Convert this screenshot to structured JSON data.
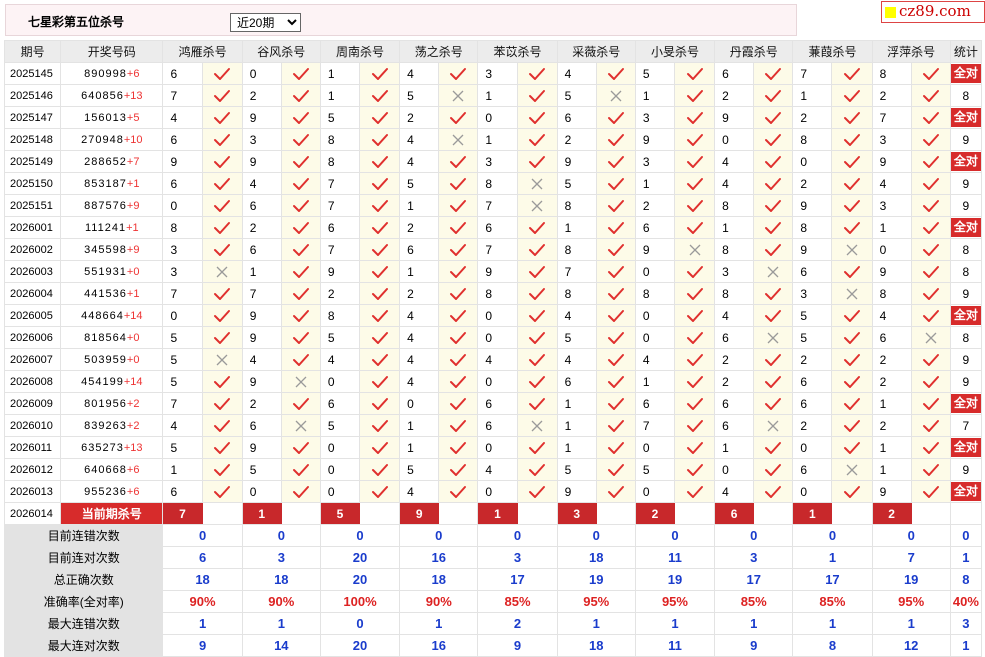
{
  "header": {
    "title": "七星彩第五位杀号",
    "period_select": {
      "value": "近20期",
      "options": [
        "近20期"
      ]
    },
    "logo_text": "cz89.com"
  },
  "columns": [
    "期号",
    "开奖号码",
    "鸿雁杀号",
    "谷风杀号",
    "周南杀号",
    "荡之杀号",
    "苯苡杀号",
    "采薇杀号",
    "小旻杀号",
    "丹霞杀号",
    "蒹葭杀号",
    "浮萍杀号",
    "统计"
  ],
  "rows": [
    {
      "period": "2025145",
      "digits": "890998",
      "plus": "+6",
      "picks": [
        [
          6,
          1
        ],
        [
          0,
          1
        ],
        [
          1,
          1
        ],
        [
          4,
          1
        ],
        [
          3,
          1
        ],
        [
          4,
          1
        ],
        [
          5,
          1
        ],
        [
          6,
          1
        ],
        [
          7,
          1
        ],
        [
          8,
          1
        ]
      ],
      "stat": "全对"
    },
    {
      "period": "2025146",
      "digits": "640856",
      "plus": "+13",
      "picks": [
        [
          7,
          1
        ],
        [
          2,
          1
        ],
        [
          1,
          1
        ],
        [
          5,
          0
        ],
        [
          1,
          1
        ],
        [
          5,
          0
        ],
        [
          1,
          1
        ],
        [
          2,
          1
        ],
        [
          1,
          1
        ],
        [
          2,
          1
        ]
      ],
      "stat": "8"
    },
    {
      "period": "2025147",
      "digits": "156013",
      "plus": "+5",
      "picks": [
        [
          4,
          1
        ],
        [
          9,
          1
        ],
        [
          5,
          1
        ],
        [
          2,
          1
        ],
        [
          0,
          1
        ],
        [
          6,
          1
        ],
        [
          3,
          1
        ],
        [
          9,
          1
        ],
        [
          2,
          1
        ],
        [
          7,
          1
        ]
      ],
      "stat": "全对"
    },
    {
      "period": "2025148",
      "digits": "270948",
      "plus": "+10",
      "picks": [
        [
          6,
          1
        ],
        [
          3,
          1
        ],
        [
          8,
          1
        ],
        [
          4,
          0
        ],
        [
          1,
          1
        ],
        [
          2,
          1
        ],
        [
          9,
          1
        ],
        [
          0,
          1
        ],
        [
          8,
          1
        ],
        [
          3,
          1
        ]
      ],
      "stat": "9"
    },
    {
      "period": "2025149",
      "digits": "288652",
      "plus": "+7",
      "picks": [
        [
          9,
          1
        ],
        [
          9,
          1
        ],
        [
          8,
          1
        ],
        [
          4,
          1
        ],
        [
          3,
          1
        ],
        [
          9,
          1
        ],
        [
          3,
          1
        ],
        [
          4,
          1
        ],
        [
          0,
          1
        ],
        [
          9,
          1
        ]
      ],
      "stat": "全对"
    },
    {
      "period": "2025150",
      "digits": "853187",
      "plus": "+1",
      "picks": [
        [
          6,
          1
        ],
        [
          4,
          1
        ],
        [
          7,
          1
        ],
        [
          5,
          1
        ],
        [
          8,
          0
        ],
        [
          5,
          1
        ],
        [
          1,
          1
        ],
        [
          4,
          1
        ],
        [
          2,
          1
        ],
        [
          4,
          1
        ]
      ],
      "stat": "9"
    },
    {
      "period": "2025151",
      "digits": "887576",
      "plus": "+9",
      "picks": [
        [
          0,
          1
        ],
        [
          6,
          1
        ],
        [
          7,
          1
        ],
        [
          1,
          1
        ],
        [
          7,
          0
        ],
        [
          8,
          1
        ],
        [
          2,
          1
        ],
        [
          8,
          1
        ],
        [
          9,
          1
        ],
        [
          3,
          1
        ]
      ],
      "stat": "9"
    },
    {
      "period": "2026001",
      "digits": "111241",
      "plus": "+1",
      "picks": [
        [
          8,
          1
        ],
        [
          2,
          1
        ],
        [
          6,
          1
        ],
        [
          2,
          1
        ],
        [
          6,
          1
        ],
        [
          1,
          1
        ],
        [
          6,
          1
        ],
        [
          1,
          1
        ],
        [
          8,
          1
        ],
        [
          1,
          1
        ]
      ],
      "stat": "全对"
    },
    {
      "period": "2026002",
      "digits": "345598",
      "plus": "+9",
      "picks": [
        [
          3,
          1
        ],
        [
          6,
          1
        ],
        [
          7,
          1
        ],
        [
          6,
          1
        ],
        [
          7,
          1
        ],
        [
          8,
          1
        ],
        [
          9,
          0
        ],
        [
          8,
          1
        ],
        [
          9,
          0
        ],
        [
          0,
          1
        ]
      ],
      "stat": "8"
    },
    {
      "period": "2026003",
      "digits": "551931",
      "plus": "+0",
      "picks": [
        [
          3,
          0
        ],
        [
          1,
          1
        ],
        [
          9,
          1
        ],
        [
          1,
          1
        ],
        [
          9,
          1
        ],
        [
          7,
          1
        ],
        [
          0,
          1
        ],
        [
          3,
          0
        ],
        [
          6,
          1
        ],
        [
          9,
          1
        ]
      ],
      "stat": "8"
    },
    {
      "period": "2026004",
      "digits": "441536",
      "plus": "+1",
      "picks": [
        [
          7,
          1
        ],
        [
          7,
          1
        ],
        [
          2,
          1
        ],
        [
          2,
          1
        ],
        [
          8,
          1
        ],
        [
          8,
          1
        ],
        [
          8,
          1
        ],
        [
          8,
          1
        ],
        [
          3,
          0
        ],
        [
          8,
          1
        ]
      ],
      "stat": "9"
    },
    {
      "period": "2026005",
      "digits": "448664",
      "plus": "+14",
      "picks": [
        [
          0,
          1
        ],
        [
          9,
          1
        ],
        [
          8,
          1
        ],
        [
          4,
          1
        ],
        [
          0,
          1
        ],
        [
          4,
          1
        ],
        [
          0,
          1
        ],
        [
          4,
          1
        ],
        [
          5,
          1
        ],
        [
          4,
          1
        ]
      ],
      "stat": "全对"
    },
    {
      "period": "2026006",
      "digits": "818564",
      "plus": "+0",
      "picks": [
        [
          5,
          1
        ],
        [
          9,
          1
        ],
        [
          5,
          1
        ],
        [
          4,
          1
        ],
        [
          0,
          1
        ],
        [
          5,
          1
        ],
        [
          0,
          1
        ],
        [
          6,
          0
        ],
        [
          5,
          1
        ],
        [
          6,
          0
        ]
      ],
      "stat": "8"
    },
    {
      "period": "2026007",
      "digits": "503959",
      "plus": "+0",
      "picks": [
        [
          5,
          0
        ],
        [
          4,
          1
        ],
        [
          4,
          1
        ],
        [
          4,
          1
        ],
        [
          4,
          1
        ],
        [
          4,
          1
        ],
        [
          4,
          1
        ],
        [
          2,
          1
        ],
        [
          2,
          1
        ],
        [
          2,
          1
        ]
      ],
      "stat": "9"
    },
    {
      "period": "2026008",
      "digits": "454199",
      "plus": "+14",
      "picks": [
        [
          5,
          1
        ],
        [
          9,
          0
        ],
        [
          0,
          1
        ],
        [
          4,
          1
        ],
        [
          0,
          1
        ],
        [
          6,
          1
        ],
        [
          1,
          1
        ],
        [
          2,
          1
        ],
        [
          6,
          1
        ],
        [
          2,
          1
        ]
      ],
      "stat": "9"
    },
    {
      "period": "2026009",
      "digits": "801956",
      "plus": "+2",
      "picks": [
        [
          7,
          1
        ],
        [
          2,
          1
        ],
        [
          6,
          1
        ],
        [
          0,
          1
        ],
        [
          6,
          1
        ],
        [
          1,
          1
        ],
        [
          6,
          1
        ],
        [
          6,
          1
        ],
        [
          6,
          1
        ],
        [
          1,
          1
        ]
      ],
      "stat": "全对"
    },
    {
      "period": "2026010",
      "digits": "839263",
      "plus": "+2",
      "picks": [
        [
          4,
          1
        ],
        [
          6,
          0
        ],
        [
          5,
          1
        ],
        [
          1,
          1
        ],
        [
          6,
          0
        ],
        [
          1,
          1
        ],
        [
          7,
          1
        ],
        [
          6,
          0
        ],
        [
          2,
          1
        ],
        [
          2,
          1
        ]
      ],
      "stat": "7"
    },
    {
      "period": "2026011",
      "digits": "635273",
      "plus": "+13",
      "picks": [
        [
          5,
          1
        ],
        [
          9,
          1
        ],
        [
          0,
          1
        ],
        [
          1,
          1
        ],
        [
          0,
          1
        ],
        [
          1,
          1
        ],
        [
          0,
          1
        ],
        [
          1,
          1
        ],
        [
          0,
          1
        ],
        [
          1,
          1
        ]
      ],
      "stat": "全对"
    },
    {
      "period": "2026012",
      "digits": "640668",
      "plus": "+6",
      "picks": [
        [
          1,
          1
        ],
        [
          5,
          1
        ],
        [
          0,
          1
        ],
        [
          5,
          1
        ],
        [
          4,
          1
        ],
        [
          5,
          1
        ],
        [
          5,
          1
        ],
        [
          0,
          1
        ],
        [
          6,
          0
        ],
        [
          1,
          1
        ]
      ],
      "stat": "9"
    },
    {
      "period": "2026013",
      "digits": "955236",
      "plus": "+6",
      "picks": [
        [
          6,
          1
        ],
        [
          0,
          1
        ],
        [
          0,
          1
        ],
        [
          4,
          1
        ],
        [
          0,
          1
        ],
        [
          9,
          1
        ],
        [
          0,
          1
        ],
        [
          4,
          1
        ],
        [
          0,
          1
        ],
        [
          9,
          1
        ]
      ],
      "stat": "全对"
    }
  ],
  "current": {
    "period": "2026014",
    "label": "当前期杀号",
    "picks": [
      "7",
      "1",
      "5",
      "9",
      "1",
      "3",
      "2",
      "6",
      "1",
      "2"
    ]
  },
  "stats": [
    {
      "label": "目前连错次数",
      "values": [
        "0",
        "0",
        "0",
        "0",
        "0",
        "0",
        "0",
        "0",
        "0",
        "0",
        "0"
      ],
      "red": false
    },
    {
      "label": "目前连对次数",
      "values": [
        "6",
        "3",
        "20",
        "16",
        "3",
        "18",
        "11",
        "3",
        "1",
        "7",
        "1"
      ],
      "red": false
    },
    {
      "label": "总正确次数",
      "values": [
        "18",
        "18",
        "20",
        "18",
        "17",
        "19",
        "19",
        "17",
        "17",
        "19",
        "8"
      ],
      "red": false
    },
    {
      "label": "准确率(全对率)",
      "values": [
        "90%",
        "90%",
        "100%",
        "90%",
        "85%",
        "95%",
        "95%",
        "85%",
        "85%",
        "95%",
        "40%"
      ],
      "red": true
    },
    {
      "label": "最大连错次数",
      "values": [
        "1",
        "1",
        "0",
        "1",
        "2",
        "1",
        "1",
        "1",
        "1",
        "1",
        "3"
      ],
      "red": false
    },
    {
      "label": "最大连对次数",
      "values": [
        "9",
        "14",
        "20",
        "16",
        "9",
        "18",
        "11",
        "9",
        "8",
        "12",
        "1"
      ],
      "red": false
    }
  ],
  "colors": {
    "accent_red": "#d72b2b",
    "check_red": "#e0302e",
    "cross_grey": "#999999",
    "stat_blue": "#1a3ccc",
    "mark_bg": "#fdfbe8"
  },
  "icons": {
    "correct": "check-icon",
    "wrong": "cross-icon"
  }
}
